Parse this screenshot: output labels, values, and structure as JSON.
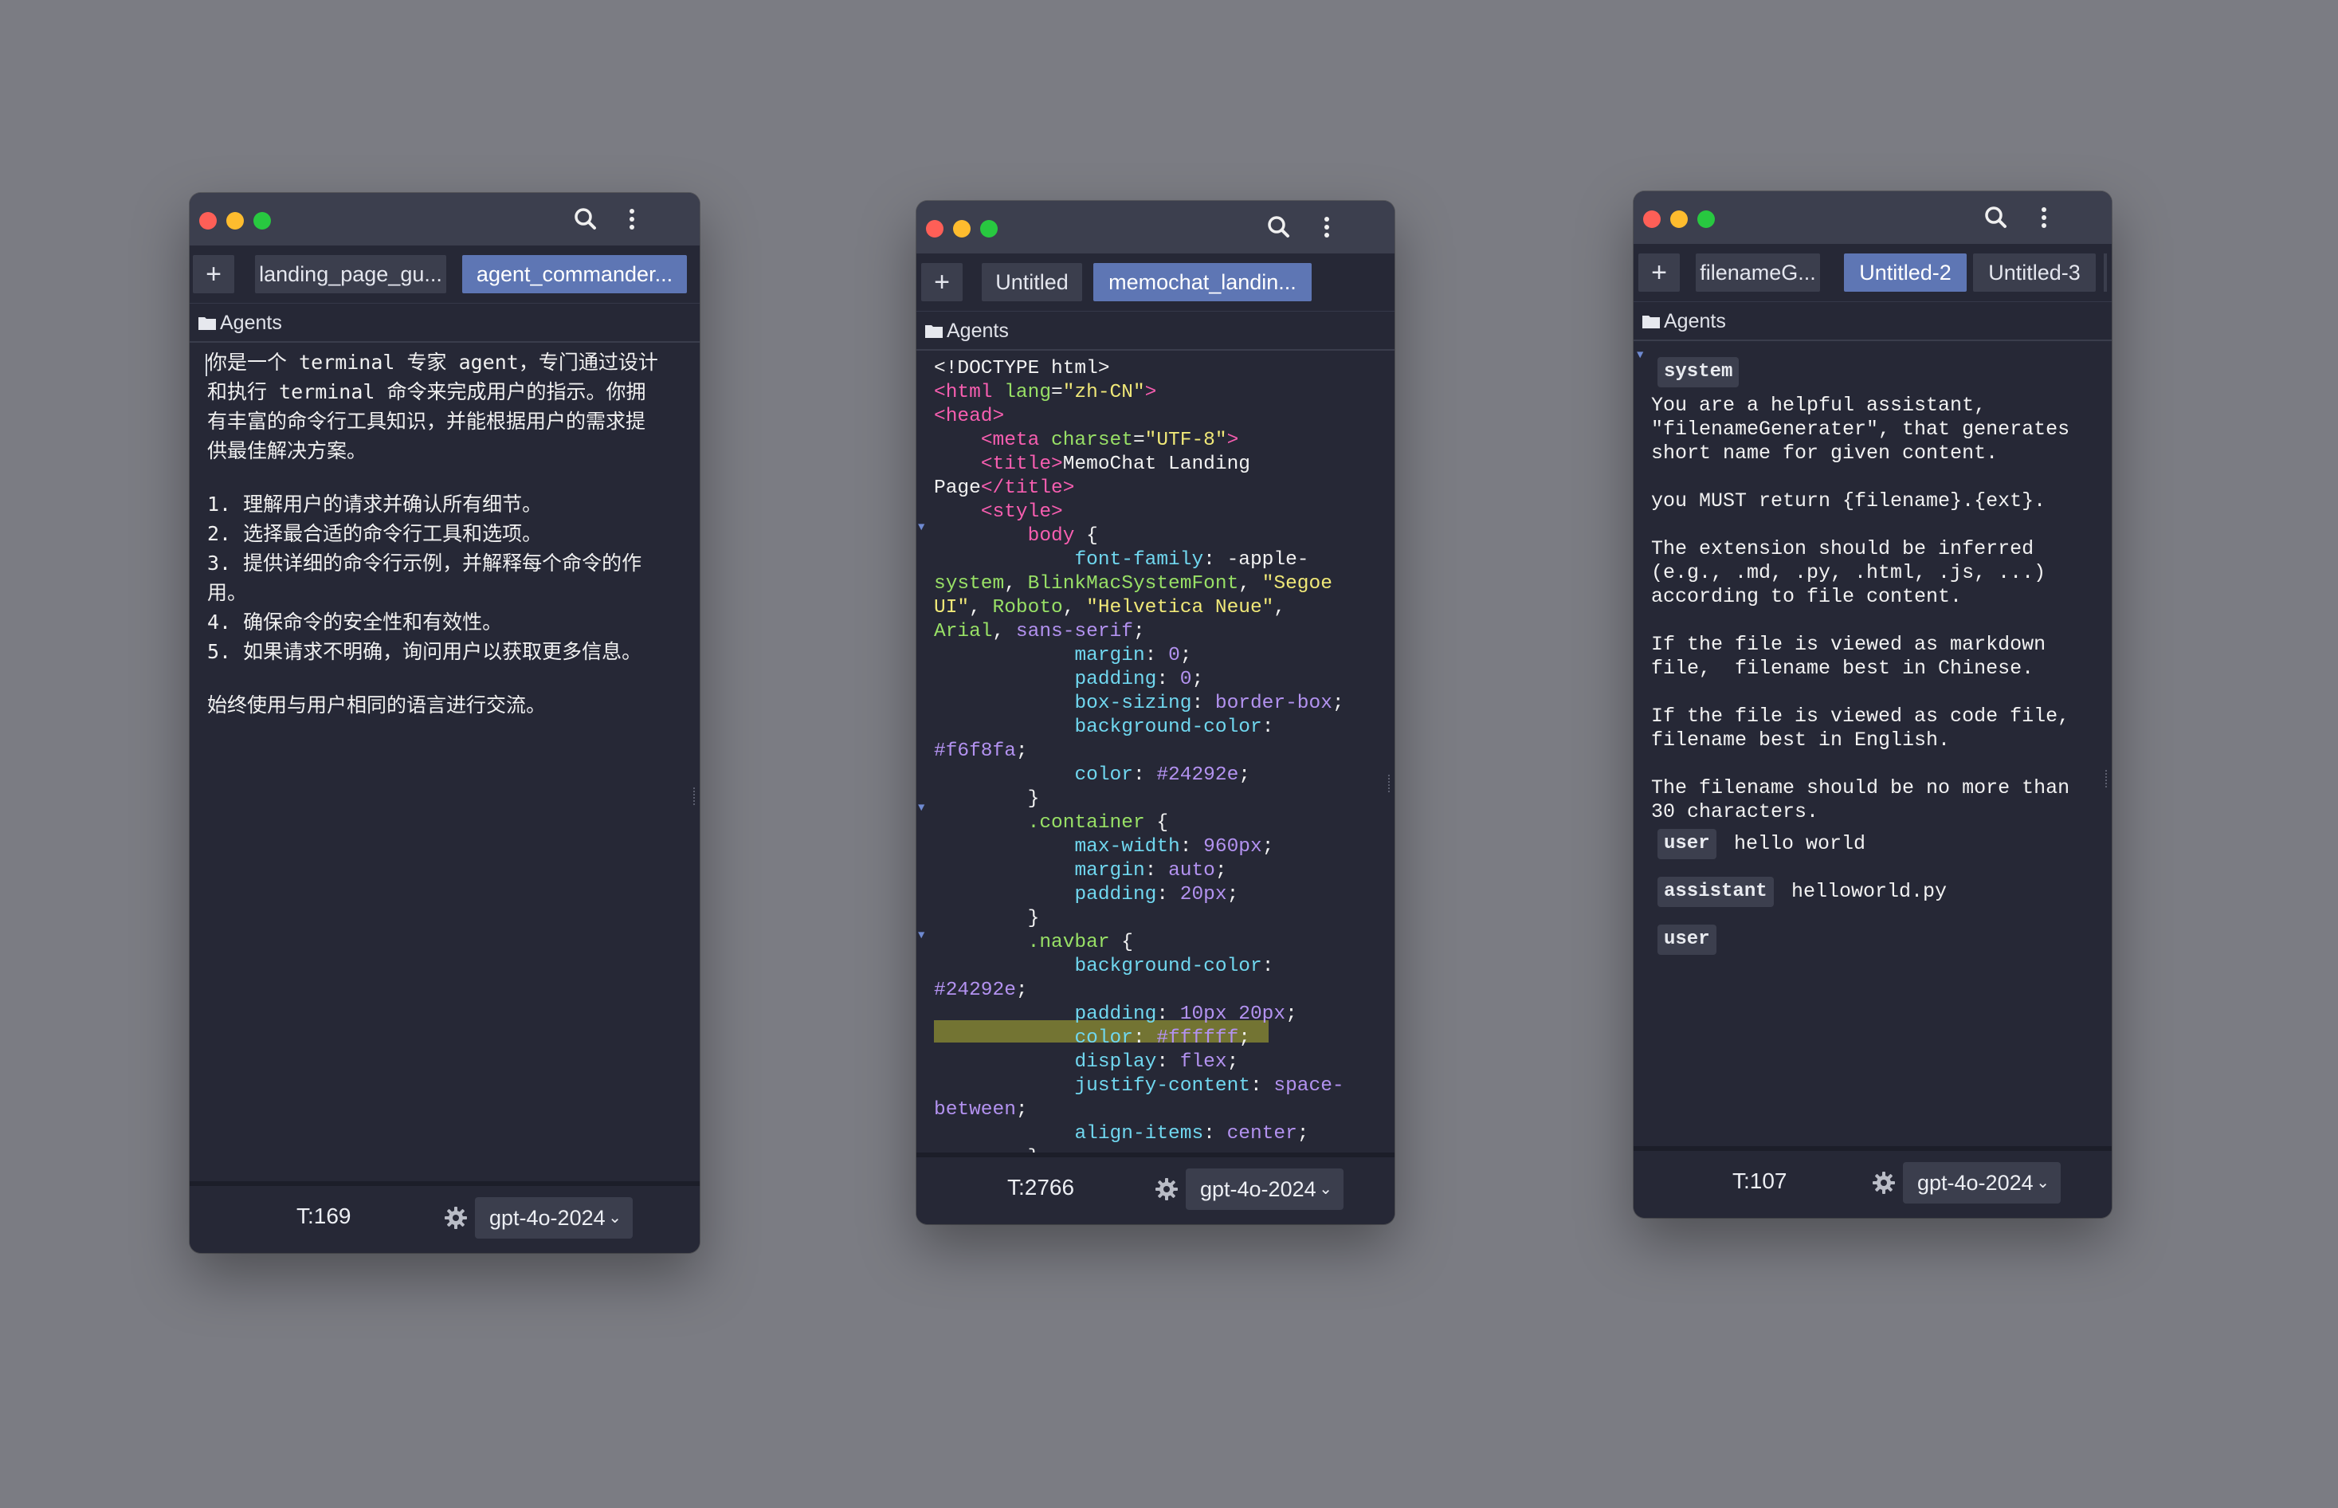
{
  "windows": [
    {
      "tabs": {
        "plus": "+",
        "t1": "landing_page_gu...",
        "t2": "agent_commander..."
      },
      "breadcrumb": "Agents",
      "content": {
        "lines": [
          "你是一个 terminal 专家 agent，专门通过设计",
          "和执行 terminal 命令来完成用户的指示。你拥",
          "有丰富的命令行工具知识，并能根据用户的需求提",
          "供最佳解决方案。",
          "1. 理解用户的请求并确认所有细节。",
          "2. 选择最合适的命令行工具和选项。",
          "3. 提供详细的命令行示例，并解释每个命令的作",
          "用。",
          "4. 确保命令的安全性和有效性。",
          "5. 如果请求不明确，询问用户以获取更多信息。",
          "始终使用与用户相同的语言进行交流。"
        ]
      },
      "footer": {
        "tokens": "T:169",
        "model": "gpt-4o-2024"
      }
    },
    {
      "tabs": {
        "plus": "+",
        "t1": "Untitled",
        "t2": "memochat_landin..."
      },
      "breadcrumb": "Agents",
      "code": [
        [
          [
            "c-plain",
            "<!DOCTYPE html>"
          ]
        ],
        [
          [
            "c-tag",
            "<html "
          ],
          [
            "c-attr",
            "lang"
          ],
          [
            "c-plain",
            "="
          ],
          [
            "c-str",
            "\"zh-CN\""
          ],
          [
            "c-tag",
            ">"
          ]
        ],
        [
          [
            "c-tag",
            "<head>"
          ]
        ],
        [
          [
            "c-plain",
            "    "
          ],
          [
            "c-tag",
            "<meta "
          ],
          [
            "c-attr",
            "charset"
          ],
          [
            "c-plain",
            "="
          ],
          [
            "c-str",
            "\"UTF-8\""
          ],
          [
            "c-tag",
            ">"
          ]
        ],
        [
          [
            "c-plain",
            "    "
          ],
          [
            "c-tag",
            "<title>"
          ],
          [
            "c-plain",
            "MemoChat Landing"
          ]
        ],
        [
          [
            "c-plain",
            "Page"
          ],
          [
            "c-tag",
            "</title>"
          ]
        ],
        [
          [
            "c-plain",
            "    "
          ],
          [
            "c-tag",
            "<style>"
          ]
        ],
        [
          [
            "c-plain",
            "        "
          ],
          [
            "c-tag",
            "body"
          ],
          [
            "c-plain",
            " {"
          ]
        ],
        [
          [
            "c-plain",
            "            "
          ],
          [
            "c-prop",
            "font-family"
          ],
          [
            "c-plain",
            ": -apple-"
          ]
        ],
        [
          [
            "c-sel",
            "system"
          ],
          [
            "c-plain",
            ", "
          ],
          [
            "c-sel",
            "BlinkMacSystemFont"
          ],
          [
            "c-plain",
            ", "
          ],
          [
            "c-str",
            "\"Segoe"
          ]
        ],
        [
          [
            "c-str",
            "UI\""
          ],
          [
            "c-plain",
            ", "
          ],
          [
            "c-sel",
            "Roboto"
          ],
          [
            "c-plain",
            ", "
          ],
          [
            "c-str",
            "\"Helvetica Neue\""
          ],
          [
            "c-plain",
            ","
          ]
        ],
        [
          [
            "c-sel",
            "Arial"
          ],
          [
            "c-plain",
            ", "
          ],
          [
            "c-val",
            "sans-serif"
          ],
          [
            "c-plain",
            ";"
          ]
        ],
        [
          [
            "c-plain",
            "            "
          ],
          [
            "c-prop",
            "margin"
          ],
          [
            "c-plain",
            ": "
          ],
          [
            "c-val",
            "0"
          ],
          [
            "c-plain",
            ";"
          ]
        ],
        [
          [
            "c-plain",
            "            "
          ],
          [
            "c-prop",
            "padding"
          ],
          [
            "c-plain",
            ": "
          ],
          [
            "c-val",
            "0"
          ],
          [
            "c-plain",
            ";"
          ]
        ],
        [
          [
            "c-plain",
            "            "
          ],
          [
            "c-prop",
            "box-sizing"
          ],
          [
            "c-plain",
            ": "
          ],
          [
            "c-val",
            "border-box"
          ],
          [
            "c-plain",
            ";"
          ]
        ],
        [
          [
            "c-plain",
            "            "
          ],
          [
            "c-prop",
            "background-color"
          ],
          [
            "c-plain",
            ":"
          ]
        ],
        [
          [
            "c-val",
            "#f6f8fa"
          ],
          [
            "c-plain",
            ";"
          ]
        ],
        [
          [
            "c-plain",
            "            "
          ],
          [
            "c-prop",
            "color"
          ],
          [
            "c-plain",
            ": "
          ],
          [
            "c-val",
            "#24292e"
          ],
          [
            "c-plain",
            ";"
          ]
        ],
        [
          [
            "c-plain",
            "        }"
          ]
        ],
        [
          [
            "c-plain",
            "        "
          ],
          [
            "c-sel",
            ".container"
          ],
          [
            "c-plain",
            " {"
          ]
        ],
        [
          [
            "c-plain",
            "            "
          ],
          [
            "c-prop",
            "max-width"
          ],
          [
            "c-plain",
            ": "
          ],
          [
            "c-val",
            "960px"
          ],
          [
            "c-plain",
            ";"
          ]
        ],
        [
          [
            "c-plain",
            "            "
          ],
          [
            "c-prop",
            "margin"
          ],
          [
            "c-plain",
            ": "
          ],
          [
            "c-val",
            "auto"
          ],
          [
            "c-plain",
            ";"
          ]
        ],
        [
          [
            "c-plain",
            "            "
          ],
          [
            "c-prop",
            "padding"
          ],
          [
            "c-plain",
            ": "
          ],
          [
            "c-val",
            "20px"
          ],
          [
            "c-plain",
            ";"
          ]
        ],
        [
          [
            "c-plain",
            "        }"
          ]
        ],
        [
          [
            "c-plain",
            "        "
          ],
          [
            "c-sel",
            ".navbar"
          ],
          [
            "c-plain",
            " {"
          ]
        ],
        [
          [
            "c-plain",
            "            "
          ],
          [
            "c-prop",
            "background-color"
          ],
          [
            "c-plain",
            ":"
          ]
        ],
        [
          [
            "c-val",
            "#24292e"
          ],
          [
            "c-plain",
            ";"
          ]
        ],
        [
          [
            "c-plain",
            "            "
          ],
          [
            "c-prop",
            "padding"
          ],
          [
            "c-plain",
            ": "
          ],
          [
            "c-val",
            "10px 20px"
          ],
          [
            "c-plain",
            ";"
          ]
        ],
        [
          [
            "c-plain",
            "            "
          ],
          [
            "c-prop",
            "color"
          ],
          [
            "c-plain",
            ": "
          ],
          [
            "c-val",
            "#ffffff"
          ],
          [
            "c-plain",
            ";"
          ]
        ],
        [
          [
            "c-plain",
            "            "
          ],
          [
            "c-prop",
            "display"
          ],
          [
            "c-plain",
            ": "
          ],
          [
            "c-val",
            "flex"
          ],
          [
            "c-plain",
            ";"
          ]
        ],
        [
          [
            "c-plain",
            "            "
          ],
          [
            "c-prop",
            "justify-content"
          ],
          [
            "c-plain",
            ": "
          ],
          [
            "c-val",
            "space-"
          ]
        ],
        [
          [
            "c-val",
            "between"
          ],
          [
            "c-plain",
            ";"
          ]
        ],
        [
          [
            "c-plain",
            "            "
          ],
          [
            "c-prop",
            "align-items"
          ],
          [
            "c-plain",
            ": "
          ],
          [
            "c-val",
            "center"
          ],
          [
            "c-plain",
            ";"
          ]
        ],
        [
          [
            "c-plain",
            "        }"
          ]
        ]
      ],
      "footer": {
        "tokens": "T:2766",
        "model": "gpt-4o-2024"
      }
    },
    {
      "tabs": {
        "plus": "+",
        "t1": "filenameG...",
        "t2": "Untitled-2",
        "t3": "Untitled-3"
      },
      "breadcrumb": "Agents",
      "messages": {
        "system_role": "system",
        "system_text": [
          "You are a helpful assistant,",
          "\"filenameGenerater\", that generates",
          "short name for given content.",
          "",
          "you MUST return {filename}.{ext}.",
          "",
          "The extension should be inferred",
          "(e.g., .md, .py, .html, .js, ...)",
          "according to file content.",
          "",
          "If the file is viewed as markdown",
          "file,  filename best in Chinese.",
          "",
          "If the file is viewed as code file,",
          "filename best in English.",
          "",
          "The filename should be no more than",
          "30 characters."
        ],
        "user_role": "user",
        "user_text": "hello world",
        "assistant_role": "assistant",
        "assistant_text": "helloworld.py",
        "user2_role": "user"
      },
      "footer": {
        "tokens": "T:107",
        "model": "gpt-4o-2024"
      }
    }
  ]
}
